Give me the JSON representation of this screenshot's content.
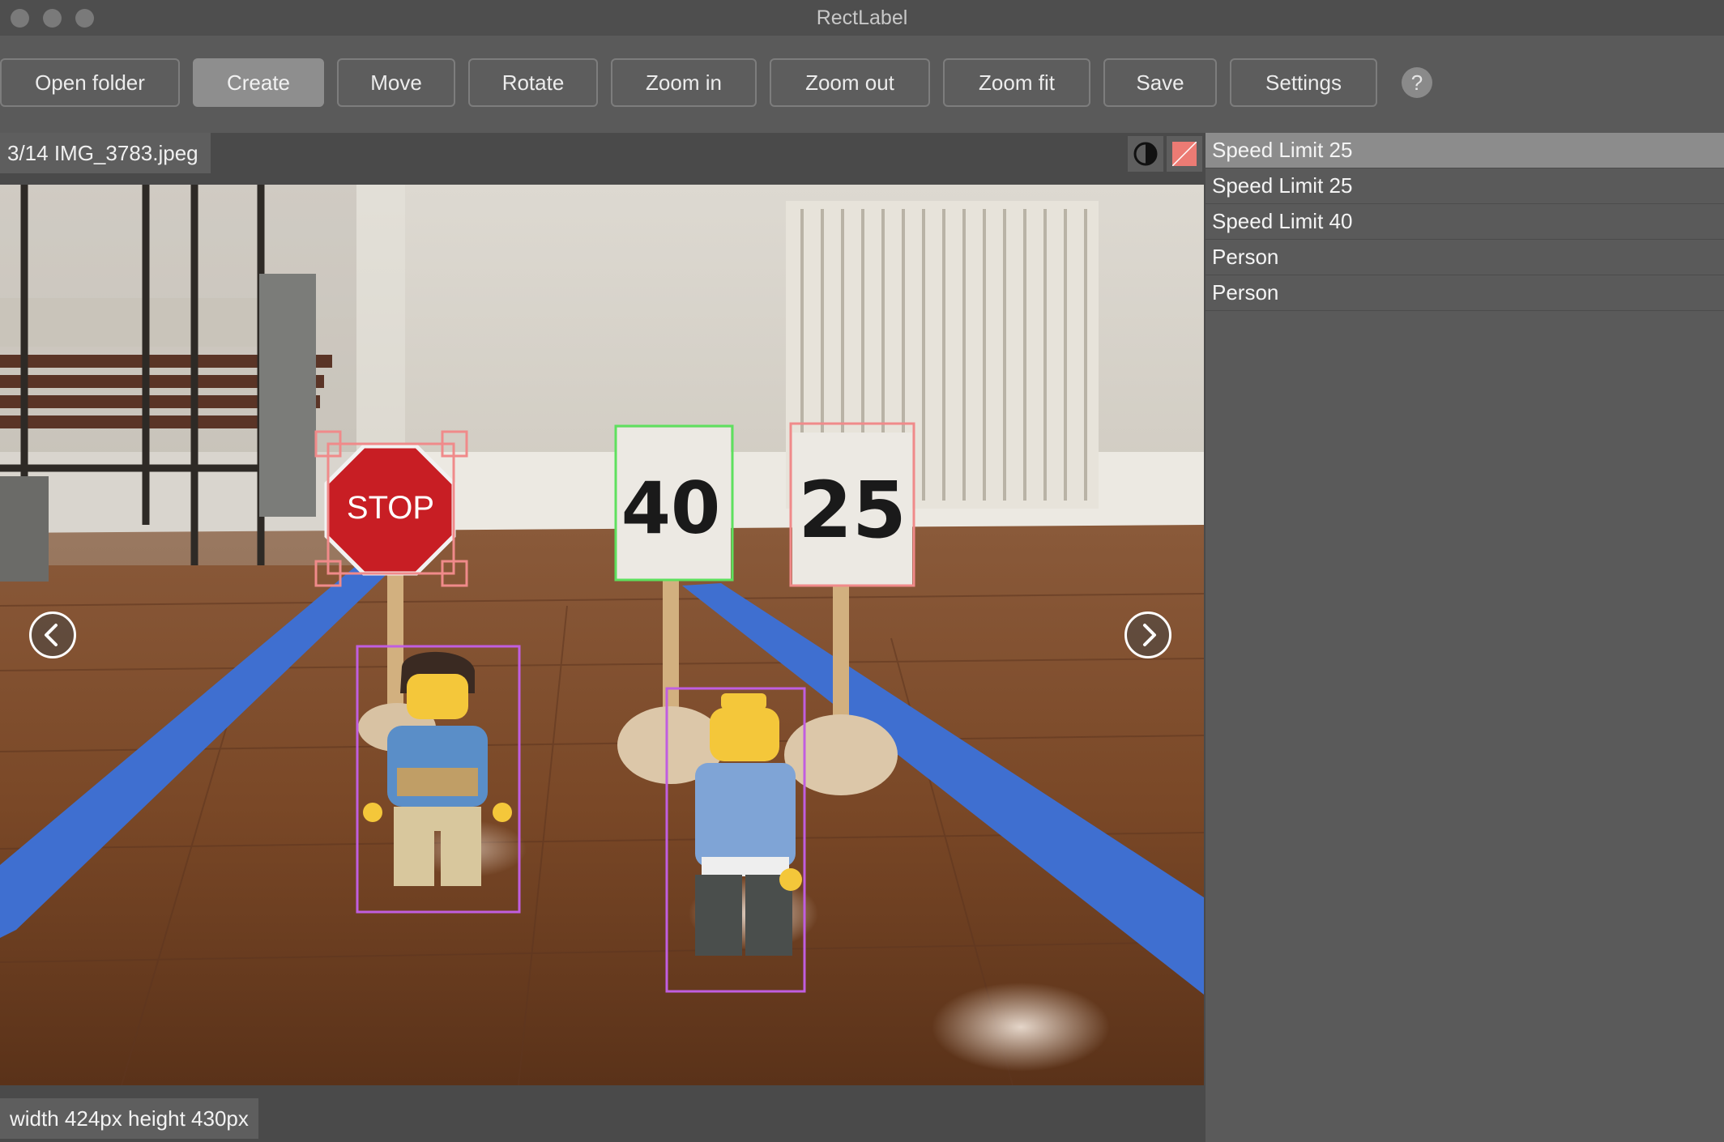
{
  "app": {
    "title": "RectLabel"
  },
  "toolbar": {
    "buttons": [
      {
        "label": "Open folder"
      },
      {
        "label": "Create"
      },
      {
        "label": "Move"
      },
      {
        "label": "Rotate"
      },
      {
        "label": "Zoom in"
      },
      {
        "label": "Zoom out"
      },
      {
        "label": "Zoom fit"
      },
      {
        "label": "Save"
      },
      {
        "label": "Settings"
      }
    ],
    "active": "Create",
    "help_label": "?"
  },
  "file": {
    "label": "3/14 IMG_3783.jpeg"
  },
  "canvas": {
    "stop_sign_text": "STOP",
    "sign_40_text": "40",
    "sign_25_text": "25",
    "colors": {
      "speed_limit_box": "#f08a8a",
      "selected_box": "#5ee05e",
      "person_box": "#c05ee0",
      "tape": "#3f6fd0"
    }
  },
  "status": {
    "text": "width 424px height 430px"
  },
  "labels": {
    "items": [
      {
        "label": "Speed Limit 25"
      },
      {
        "label": "Speed Limit 25"
      },
      {
        "label": "Speed Limit 40"
      },
      {
        "label": "Person"
      },
      {
        "label": "Person"
      }
    ],
    "selected_index": 0
  },
  "icons": {
    "contrast": "contrast-icon",
    "color": "color-swatch-icon",
    "prev": "chevron-left-icon",
    "next": "chevron-right-icon"
  }
}
